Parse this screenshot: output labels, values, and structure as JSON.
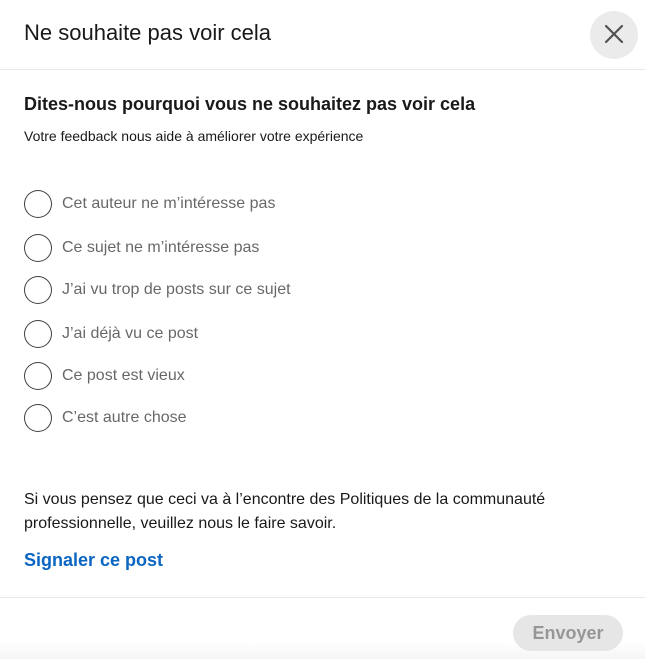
{
  "modal": {
    "title": "Ne souhaite pas voir cela",
    "close_icon": "close-icon"
  },
  "feedback": {
    "question": "Dites-nous pourquoi vous ne souhaitez pas voir cela",
    "subtitle": "Votre feedback nous aide à améliorer votre expérience",
    "options": [
      {
        "label": "Cet auteur ne m’intéresse pas",
        "selected": false
      },
      {
        "label": "Ce sujet ne m’intéresse pas",
        "selected": false
      },
      {
        "label": "J’ai vu trop de posts sur ce sujet",
        "selected": false
      },
      {
        "label": "J’ai déjà vu ce post",
        "selected": false
      },
      {
        "label": "Ce post est vieux",
        "selected": false
      },
      {
        "label": "C’est autre chose",
        "selected": false
      }
    ]
  },
  "policy": {
    "text": "Si vous pensez que ceci va à l’encontre des Politiques de la communauté professionnelle, veuillez nous le faire savoir.",
    "report_link": "Signaler ce post"
  },
  "footer": {
    "send_label": "Envoyer",
    "send_disabled": true
  },
  "colors": {
    "link": "#0a66c2",
    "close_bg": "#ebebeb",
    "disabled_button_bg": "#e6e6e6"
  }
}
